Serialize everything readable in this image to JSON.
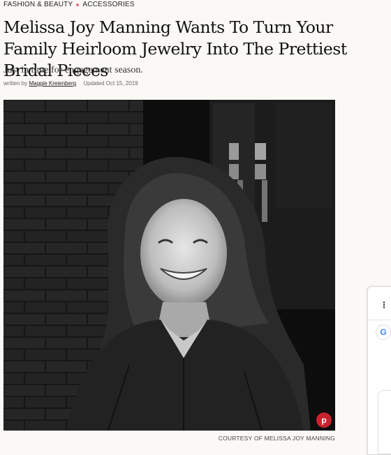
{
  "breadcrumb": {
    "category": "FASHION & BEAUTY",
    "subcategory": "ACCESSORIES"
  },
  "article": {
    "title": "Melissa Joy Manning Wants To Turn Your Family Heirloom Jewelry Into The Prettiest Bridal Pieces",
    "dek": "Just in time for engagement season.",
    "byline_prefix": "written by",
    "author": "Maggie Kreienberg",
    "updated": "Updated Oct 15, 2019"
  },
  "hero": {
    "alt": "Portrait of Melissa Joy Manning",
    "credit": "COURTESY OF MELISSA JOY MANNING",
    "pin_glyph": "p",
    "pin_color": "#c8232c"
  },
  "side_panel": {
    "menu_icon": "⋮",
    "google_glyph": "G"
  }
}
